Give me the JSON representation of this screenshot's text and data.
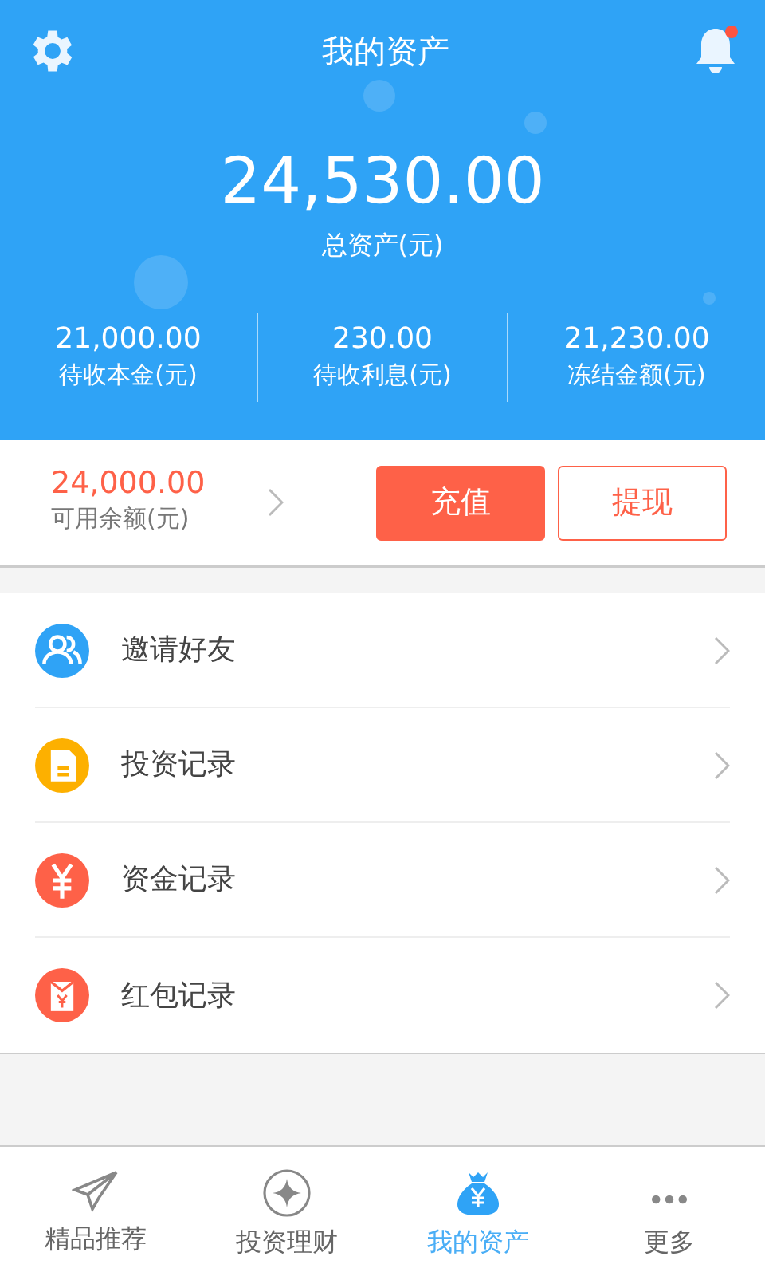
{
  "header": {
    "title": "我的资产",
    "has_notification": true
  },
  "total": {
    "amount": "24,530.00",
    "label": "总资产(元)"
  },
  "stats": [
    {
      "amount": "21,000.00",
      "label": "待收本金(元)"
    },
    {
      "amount": "230.00",
      "label": "待收利息(元)"
    },
    {
      "amount": "21,230.00",
      "label": "冻结金额(元)"
    }
  ],
  "balance": {
    "amount": "24,000.00",
    "label": "可用余额(元)"
  },
  "buttons": [
    {
      "label": "充值",
      "kind": "primary"
    },
    {
      "label": "提现",
      "kind": "outline"
    }
  ],
  "menu": [
    {
      "label": "邀请好友",
      "kind": "people",
      "color": "#2fa3f6"
    },
    {
      "label": "投资记录",
      "kind": "document",
      "color": "#fdb000"
    },
    {
      "label": "资金记录",
      "kind": "yen",
      "color": "#fe6148"
    },
    {
      "label": "红包记录",
      "kind": "envelope",
      "color": "#fe6148"
    }
  ],
  "tabs": [
    {
      "label": "精品推荐",
      "kind": "plane",
      "selected": false
    },
    {
      "label": "投资理财",
      "kind": "diamond",
      "selected": false
    },
    {
      "label": "我的资产",
      "kind": "moneybag",
      "selected": true
    },
    {
      "label": "更多",
      "kind": "more",
      "selected": false
    }
  ]
}
